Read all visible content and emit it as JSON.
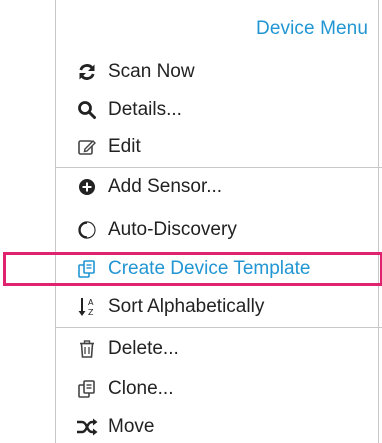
{
  "menu": {
    "title": "Device Menu",
    "items": [
      {
        "label": "Scan Now",
        "icon": "refresh-icon"
      },
      {
        "label": "Details...",
        "icon": "search-icon"
      },
      {
        "label": "Edit",
        "icon": "edit-icon"
      },
      {
        "label": "Add Sensor...",
        "icon": "add-circle-icon"
      },
      {
        "label": "Auto-Discovery",
        "icon": "auto-discovery-icon"
      },
      {
        "label": "Create Device Template",
        "icon": "template-icon",
        "highlighted": true
      },
      {
        "label": "Sort Alphabetically",
        "icon": "sort-az-icon"
      },
      {
        "label": "Delete...",
        "icon": "trash-icon"
      },
      {
        "label": "Clone...",
        "icon": "clone-icon"
      },
      {
        "label": "Move",
        "icon": "move-icon"
      }
    ]
  },
  "colors": {
    "accent": "#2196d3",
    "highlight_border": "#e0236e",
    "text": "#222222",
    "separator": "#c8c8c8"
  }
}
